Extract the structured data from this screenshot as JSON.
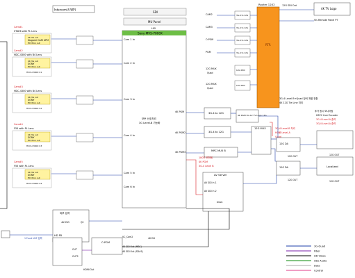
{
  "cameras": [
    {
      "id": "cam1",
      "label": "Cam#1",
      "lens": "STARK with PL Lens",
      "model": "4K 3G out",
      "brand": "Nogami CAM 4PM",
      "sub": "HD Mon out"
    },
    {
      "id": "cam2",
      "label": "Cam#2",
      "lens": "HDC-4300 with B4 Lens",
      "model": "4K 3G out",
      "brand": "SONY",
      "sub": "HD Mon out",
      "ccu": "HCCU-3000 C1"
    },
    {
      "id": "cam3",
      "label": "Cam#3",
      "lens": "HDC-4300 with B4 Lens",
      "model": "4K 3G out",
      "brand": "SONY",
      "sub": "HD Mon out",
      "ccu": "HCCU-3000 C2"
    },
    {
      "id": "cam4",
      "label": "Cam#4",
      "lens": "F55 with PL Lens",
      "model": "4K 3G out",
      "brand": "SONY",
      "sub": "HD Mon out",
      "ccu": "HCCU-3000 C3"
    },
    {
      "id": "cam5",
      "label": "Cam#5",
      "lens": "F55 with PL Lens",
      "model": "4K 3G out",
      "brand": "SONY",
      "sub": "HD Mon out",
      "ccu": "HCCU-3000 C4"
    }
  ],
  "top": {
    "intercom": "Intercom(4-WP)",
    "sdi": "SDI",
    "mu_panel": "MU Panel",
    "switcher_head": "HSI",
    "switcher": "Sony MVS-7000X"
  },
  "switcher_inputs": [
    "Cam 1 In",
    "Cam 2 In",
    "Cam 3 In",
    "Cam 4 In",
    "Cam 5 In",
    "Cam 6 In"
  ],
  "switcher_outputs": [
    "4K PGM",
    "4K PGM2",
    "4K PGM3"
  ],
  "switcher_note": [
    "모든 신호처리",
    "3G Level-B 가능화"
  ],
  "router": {
    "title": "Router 12X2",
    "label": "RTR",
    "out": "12G SDI Out"
  },
  "router_inputs": [
    "CAM2",
    "CAM3",
    "O PGM",
    "PGM"
  ],
  "mux_boxes": [
    "12G MUX",
    "12G MUX"
  ],
  "mux_labels": [
    "Quad",
    "Quad"
  ],
  "conv_boxes": [
    "3G-4 to 12G",
    "3G-4 to 12G",
    "3G-4 to 12G",
    "3G-4 to 12G"
  ],
  "right_top": {
    "title": "4K TV Logo",
    "sub": "Vis Remote Panel PT"
  },
  "mid": {
    "box1": "3G-4 to 12G",
    "box2": "3G-4 to 12G",
    "logo": "4K PGM 3G-12 TV Logo 12G",
    "mux": "12G MUX",
    "mux2": "MRC MUX B"
  },
  "server": {
    "title": "AV Server",
    "lines": [
      "AV SDI In 1",
      "AV SDI In 2"
    ],
    "deck": "Deck"
  },
  "notes_red": [
    "3G/4 Level-B 처리",
    "HD용 Level-A",
    "Quad"
  ],
  "notes_red2": [
    "180도 반전됨",
    "4K PGM",
    "3G-4 Level B"
  ],
  "korean_note": [
    "3G-4 Level B→Quad 장비 개별 전환",
    "4K 12G Tie Line 처리"
  ],
  "right_notes": [
    "추가 동시 모니터링",
    "HEVC Live Encoder",
    "3G-4 Level A 출력",
    "3G/4 Level-A 출력"
  ],
  "split_labels": [
    "12G DA",
    "12G DA"
  ],
  "out_labels": [
    "12G OUT",
    "12G OUT",
    "12G OUT",
    "12G OUT"
  ],
  "localized": "Localized",
  "bottom_left": {
    "hdd_title": "외부 입력",
    "sys": "4K DG",
    "sys_sub": "Q2",
    "fb": "HD FB",
    "input": "1 Front UHF 입력",
    "outs": [
      "OUT",
      "OUT2"
    ]
  },
  "bottom_center": {
    "vc": "VC_Cam2",
    "o_pgm": "O PGM",
    "oth": [
      "4K SDI Out (MBC)",
      "4K SDI Out (SD#1)"
    ],
    "dd": "4K DG",
    "hdmi": "HDMI Out"
  },
  "legend": [
    "3G-Quad",
    "Fiber",
    "HD Video",
    "AES Audio",
    "Data",
    "Control"
  ],
  "legend_colors": [
    "#1f3fa8",
    "#7a1fa8",
    "#000000",
    "#0a8a0a",
    "#aaaaaa",
    "#e03c8a"
  ],
  "colors": {
    "accent_green": "#6dbe45",
    "router_orange": "#f7941d",
    "camera_yellow": "#fff3a0",
    "red": "#d71920",
    "blue": "#1f3fa8"
  }
}
